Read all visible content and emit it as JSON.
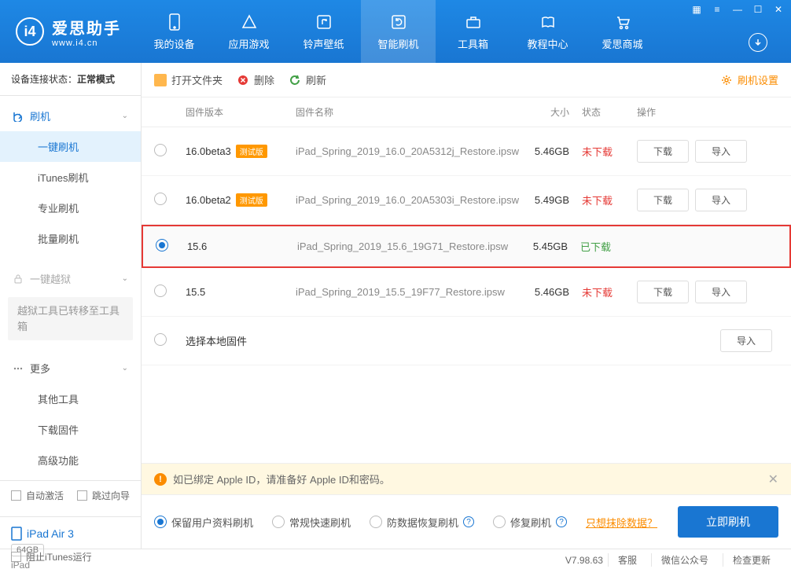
{
  "app": {
    "name": "爱思助手",
    "url": "www.i4.cn"
  },
  "nav": {
    "items": [
      "我的设备",
      "应用游戏",
      "铃声壁纸",
      "智能刷机",
      "工具箱",
      "教程中心",
      "爱思商城"
    ],
    "activeIndex": 3
  },
  "sidebar": {
    "statusLabel": "设备连接状态：",
    "statusValue": "正常模式",
    "sections": {
      "flash": {
        "title": "刷机",
        "items": [
          "一键刷机",
          "iTunes刷机",
          "专业刷机",
          "批量刷机"
        ]
      },
      "jailbreak": {
        "title": "一键越狱",
        "notice": "越狱工具已转移至工具箱"
      },
      "more": {
        "title": "更多",
        "items": [
          "其他工具",
          "下载固件",
          "高级功能"
        ]
      }
    },
    "autoActivate": "自动激活",
    "skipGuide": "跳过向导"
  },
  "device": {
    "name": "iPad Air 3",
    "storage": "64GB",
    "type": "iPad"
  },
  "toolbar": {
    "openFolder": "打开文件夹",
    "delete": "删除",
    "refresh": "刷新",
    "settings": "刷机设置"
  },
  "table": {
    "headers": {
      "version": "固件版本",
      "name": "固件名称",
      "size": "大小",
      "status": "状态",
      "action": "操作"
    },
    "betaLabel": "测试版",
    "downloadBtn": "下载",
    "importBtn": "导入",
    "localFirmware": "选择本地固件",
    "rows": [
      {
        "version": "16.0beta3",
        "beta": true,
        "name": "iPad_Spring_2019_16.0_20A5312j_Restore.ipsw",
        "size": "5.46GB",
        "status": "未下载",
        "downloaded": false,
        "selected": false
      },
      {
        "version": "16.0beta2",
        "beta": true,
        "name": "iPad_Spring_2019_16.0_20A5303i_Restore.ipsw",
        "size": "5.49GB",
        "status": "未下载",
        "downloaded": false,
        "selected": false
      },
      {
        "version": "15.6",
        "beta": false,
        "name": "iPad_Spring_2019_15.6_19G71_Restore.ipsw",
        "size": "5.45GB",
        "status": "已下载",
        "downloaded": true,
        "selected": true
      },
      {
        "version": "15.5",
        "beta": false,
        "name": "iPad_Spring_2019_15.5_19F77_Restore.ipsw",
        "size": "5.46GB",
        "status": "未下载",
        "downloaded": false,
        "selected": false
      }
    ]
  },
  "notice": "如已绑定 Apple ID，请准备好 Apple ID和密码。",
  "flashOptions": {
    "keepData": "保留用户资料刷机",
    "normal": "常规快速刷机",
    "antiRecovery": "防数据恢复刷机",
    "repair": "修复刷机",
    "eraseLink": "只想抹除数据？",
    "flashBtn": "立即刷机"
  },
  "statusbar": {
    "blockITunes": "阻止iTunes运行",
    "version": "V7.98.63",
    "support": "客服",
    "wechat": "微信公众号",
    "update": "检查更新"
  }
}
